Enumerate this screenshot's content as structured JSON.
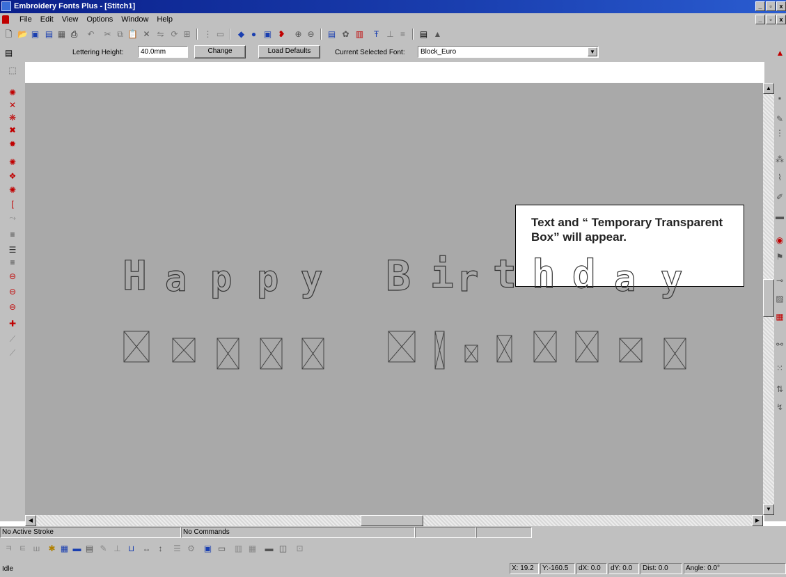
{
  "window": {
    "title": "Embroidery Fonts Plus - [Stitch1]",
    "buttons": [
      "_",
      "▫",
      "x"
    ]
  },
  "menu": {
    "items": [
      "File",
      "Edit",
      "View",
      "Options",
      "Window",
      "Help"
    ]
  },
  "lettering_toolbar": {
    "height_label": "Lettering Height:",
    "height_value": "40.0mm",
    "change_button": "Change",
    "load_defaults_button": "Load Defaults",
    "font_label": "Current Selected Font:",
    "font_value": "Block_Euro"
  },
  "callout": {
    "text": "Text and “ Temporary Transparent Box” will appear."
  },
  "canvas": {
    "word1": [
      "H",
      "a",
      "p",
      "p",
      "y"
    ],
    "word2": [
      "B",
      "i",
      "r",
      "t",
      "h",
      "d",
      "a",
      "y"
    ]
  },
  "status": {
    "stroke": "No Active Stroke",
    "commands": "No Commands",
    "idle": "Idle",
    "x": "X: 19.2",
    "y": "Y:-160.5",
    "dx": "dX: 0.0",
    "dy": "dY: 0.0",
    "dist": "Dist: 0.0",
    "angle": "Angle: 0.0°"
  },
  "icons": {
    "toolbar": [
      "new-icon",
      "open-icon",
      "save-icon",
      "print-icon",
      "cut-icon",
      "copy-icon",
      "paste-icon",
      "delete-icon",
      "zoom-in-icon",
      "zoom-out-icon"
    ],
    "colors": {
      "title_bar": "#0a1f8a",
      "canvas": "#a9a9a9",
      "accent_red": "#c00000"
    }
  }
}
